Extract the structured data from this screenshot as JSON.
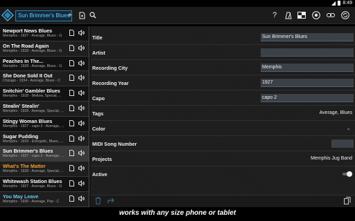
{
  "status": {
    "time": "8:49"
  },
  "toolbar": {
    "app_title": "Sun Brimmer's Blues",
    "icons": [
      "add-icon",
      "new-document-icon",
      "search-icon",
      "help-icon",
      "metronome-icon",
      "grid-icon",
      "soccer-ball-icon",
      "link-icon",
      "sync-icon"
    ]
  },
  "songs": [
    {
      "title": "Newport News Blues",
      "sub": "Memphis - 1927 - Average, Blues - G",
      "style": "normal"
    },
    {
      "title": "On The Road Again",
      "sub": "Memphis - 1928 - Average, Blues - G",
      "style": "normal"
    },
    {
      "title": "Peaches In The...",
      "sub": "Memphis - 1928 - Average, Blues - G",
      "style": "normal"
    },
    {
      "title": "She Done Sold It Out",
      "sub": "Chicago - 1934 - Average, Blues - C",
      "style": "normal"
    },
    {
      "title": "Snitchin' Gambler Blues",
      "sub": "Memphis - 1928 - Mellow, Special, ...",
      "style": "normal"
    },
    {
      "title": "Stealin' Stealin'",
      "sub": "Memphis - 1928 - Average, Special, ...",
      "style": "normal"
    },
    {
      "title": "Stingy Woman Blues",
      "sub": "Memphis - 1927 - capo 2 - Average, ...",
      "style": "normal"
    },
    {
      "title": "Sugar Pudding",
      "sub": "Memphis - 1929 - Energetic, Blues, ...",
      "style": "normal"
    },
    {
      "title": "Sun Brimmer's Blues",
      "sub": "Memphis - 1927 - capo 2 - Average, ...",
      "style": "selected"
    },
    {
      "title": "What's The Matter",
      "sub": "Memphis - 1928 - Average, Special, ...",
      "style": "orange"
    },
    {
      "title": "Whitewash Station Blues",
      "sub": "Memphis - 1927 - Average, Blues - G",
      "style": "normal"
    },
    {
      "title": "You May Leave",
      "sub": "Memphis - 1930 - Average, Pop - C",
      "style": "blue"
    }
  ],
  "detail": {
    "title_label": "Title",
    "title_value": "Sun Brimmer's Blues",
    "artist_label": "Artist",
    "artist_value": "",
    "city_label": "Recording City",
    "city_value": "Memphis",
    "year_label": "Recording Year",
    "year_value": "1927",
    "capo_label": "Capo",
    "capo_value": "capo 2",
    "tags_label": "Tags",
    "tags_value": "Average, Blues",
    "color_label": "Color",
    "midi_label": "MIDI Song Number",
    "midi_value": "",
    "projects_label": "Projects",
    "projects_value": "Memphis Jug Band",
    "active_label": "Active",
    "active_on": true
  },
  "caption": "works with any size phone or tablet"
}
